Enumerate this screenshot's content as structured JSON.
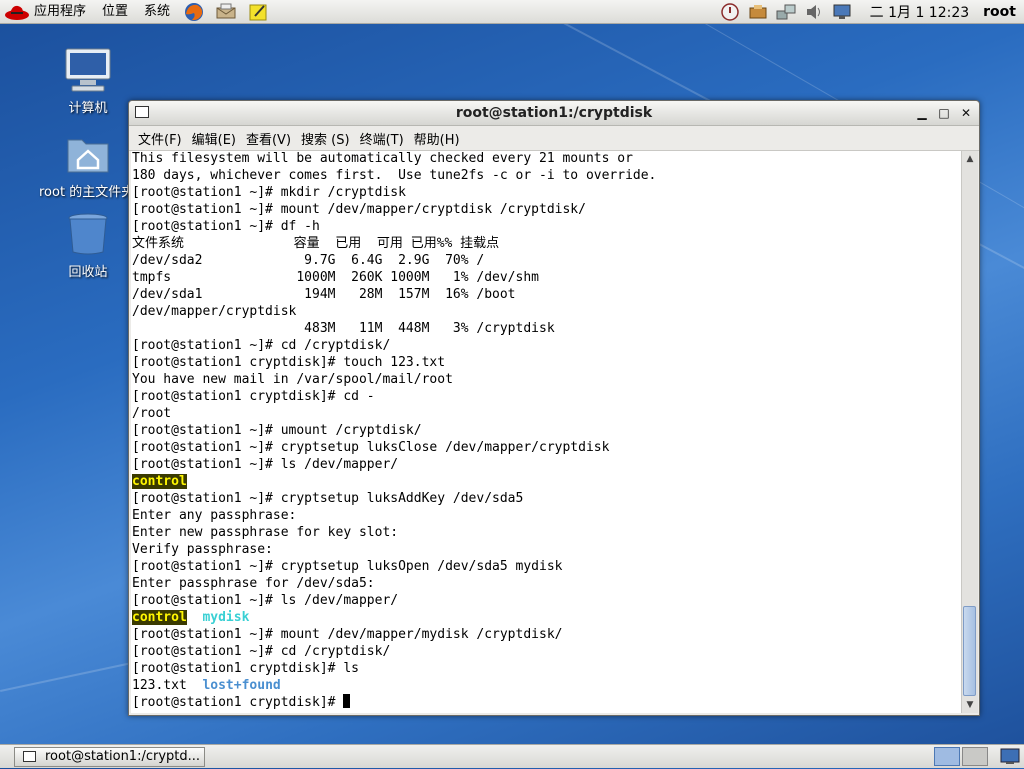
{
  "top_panel": {
    "applications": "应用程序",
    "places": "位置",
    "system": "系统",
    "clock": "二 1月  1 12:23",
    "user": "root"
  },
  "desktop": {
    "computer_label": "计算机",
    "home_label": "root 的主文件夹",
    "trash_label": "回收站"
  },
  "window": {
    "title": "root@station1:/cryptdisk",
    "menus": [
      "文件(F)",
      "编辑(E)",
      "查看(V)",
      "搜索 (S)",
      "终端(T)",
      "帮助(H)"
    ]
  },
  "terminal": {
    "lines": [
      "This filesystem will be automatically checked every 21 mounts or",
      "180 days, whichever comes first.  Use tune2fs -c or -i to override.",
      "[root@station1 ~]# mkdir /cryptdisk",
      "[root@station1 ~]# mount /dev/mapper/cryptdisk /cryptdisk/",
      "[root@station1 ~]# df -h",
      "文件系统              容量  已用  可用 已用%% 挂载点",
      "/dev/sda2             9.7G  6.4G  2.9G  70% /",
      "tmpfs                1000M  260K 1000M   1% /dev/shm",
      "/dev/sda1             194M   28M  157M  16% /boot",
      "/dev/mapper/cryptdisk",
      "                      483M   11M  448M   3% /cryptdisk",
      "[root@station1 ~]# cd /cryptdisk/",
      "[root@station1 cryptdisk]# touch 123.txt",
      "You have new mail in /var/spool/mail/root",
      "[root@station1 cryptdisk]# cd -",
      "/root",
      "[root@station1 ~]# umount /cryptdisk/",
      "[root@station1 ~]# cryptsetup luksClose /dev/mapper/cryptdisk",
      "[root@station1 ~]# ls /dev/mapper/"
    ],
    "ls1_control": "control",
    "lines2": [
      "[root@station1 ~]# cryptsetup luksAddKey /dev/sda5",
      "Enter any passphrase:",
      "Enter new passphrase for key slot:",
      "Verify passphrase:",
      "[root@station1 ~]# cryptsetup luksOpen /dev/sda5 mydisk",
      "Enter passphrase for /dev/sda5:",
      "[root@station1 ~]# ls /dev/mapper/"
    ],
    "ls2_control": "control",
    "ls2_mydisk": "mydisk",
    "lines3": [
      "[root@station1 ~]# mount /dev/mapper/mydisk /cryptdisk/",
      "[root@station1 ~]# cd /cryptdisk/",
      "[root@station1 cryptdisk]# ls"
    ],
    "ls3_file": "123.txt",
    "ls3_dir": "lost+found",
    "prompt": "[root@station1 cryptdisk]# "
  },
  "taskbar": {
    "task_label": "root@station1:/cryptd..."
  },
  "colors": {
    "highlight_yellow": "#fff700",
    "highlight_cyan": "#3ad0d4",
    "highlight_blue": "#4a8fd0"
  }
}
